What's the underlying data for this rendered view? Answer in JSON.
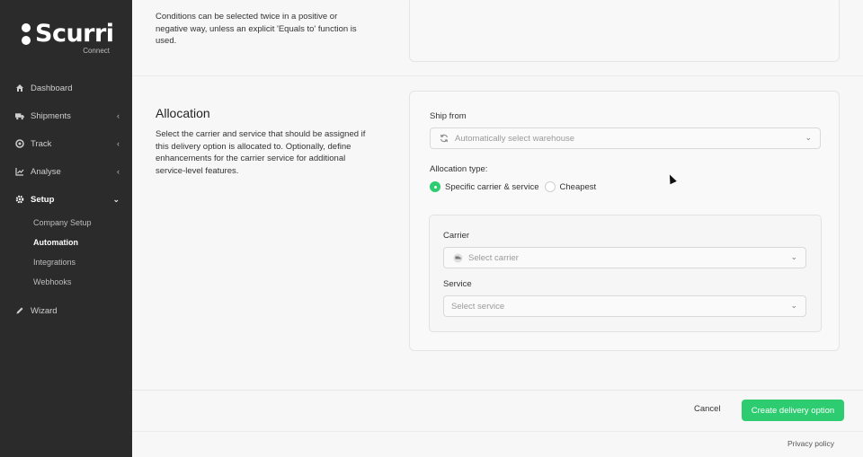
{
  "brand": {
    "name": "Scurri",
    "sub": "Connect"
  },
  "sidebar": {
    "items": [
      {
        "label": "Dashboard",
        "icon": "home-icon"
      },
      {
        "label": "Shipments",
        "icon": "truck-icon"
      },
      {
        "label": "Track",
        "icon": "target-icon"
      },
      {
        "label": "Analyse",
        "icon": "chart-icon"
      },
      {
        "label": "Setup",
        "icon": "gear-icon"
      },
      {
        "label": "Wizard",
        "icon": "pencil-icon"
      }
    ],
    "setup_sub": [
      "Company Setup",
      "Automation",
      "Integrations",
      "Webhooks"
    ]
  },
  "conditions": {
    "description": "Conditions can be selected twice in a positive or negative way, unless an explicit 'Equals to' function is used."
  },
  "allocation": {
    "title": "Allocation",
    "description": "Select the carrier and service that should be assigned if this delivery option is allocated to. Optionally, define enhancements for the carrier service for additional service-level features.",
    "ship_from_label": "Ship from",
    "ship_from_placeholder": "Automatically select warehouse",
    "type_label": "Allocation type:",
    "type_options": [
      "Specific carrier & service",
      "Cheapest"
    ],
    "selected_type": "Specific carrier & service",
    "carrier_label": "Carrier",
    "carrier_placeholder": "Select carrier",
    "service_label": "Service",
    "service_placeholder": "Select service"
  },
  "footer": {
    "cancel": "Cancel",
    "create": "Create delivery option",
    "privacy": "Privacy policy"
  },
  "colors": {
    "accent": "#2dcc70",
    "sidebar": "#2b2b2b"
  }
}
